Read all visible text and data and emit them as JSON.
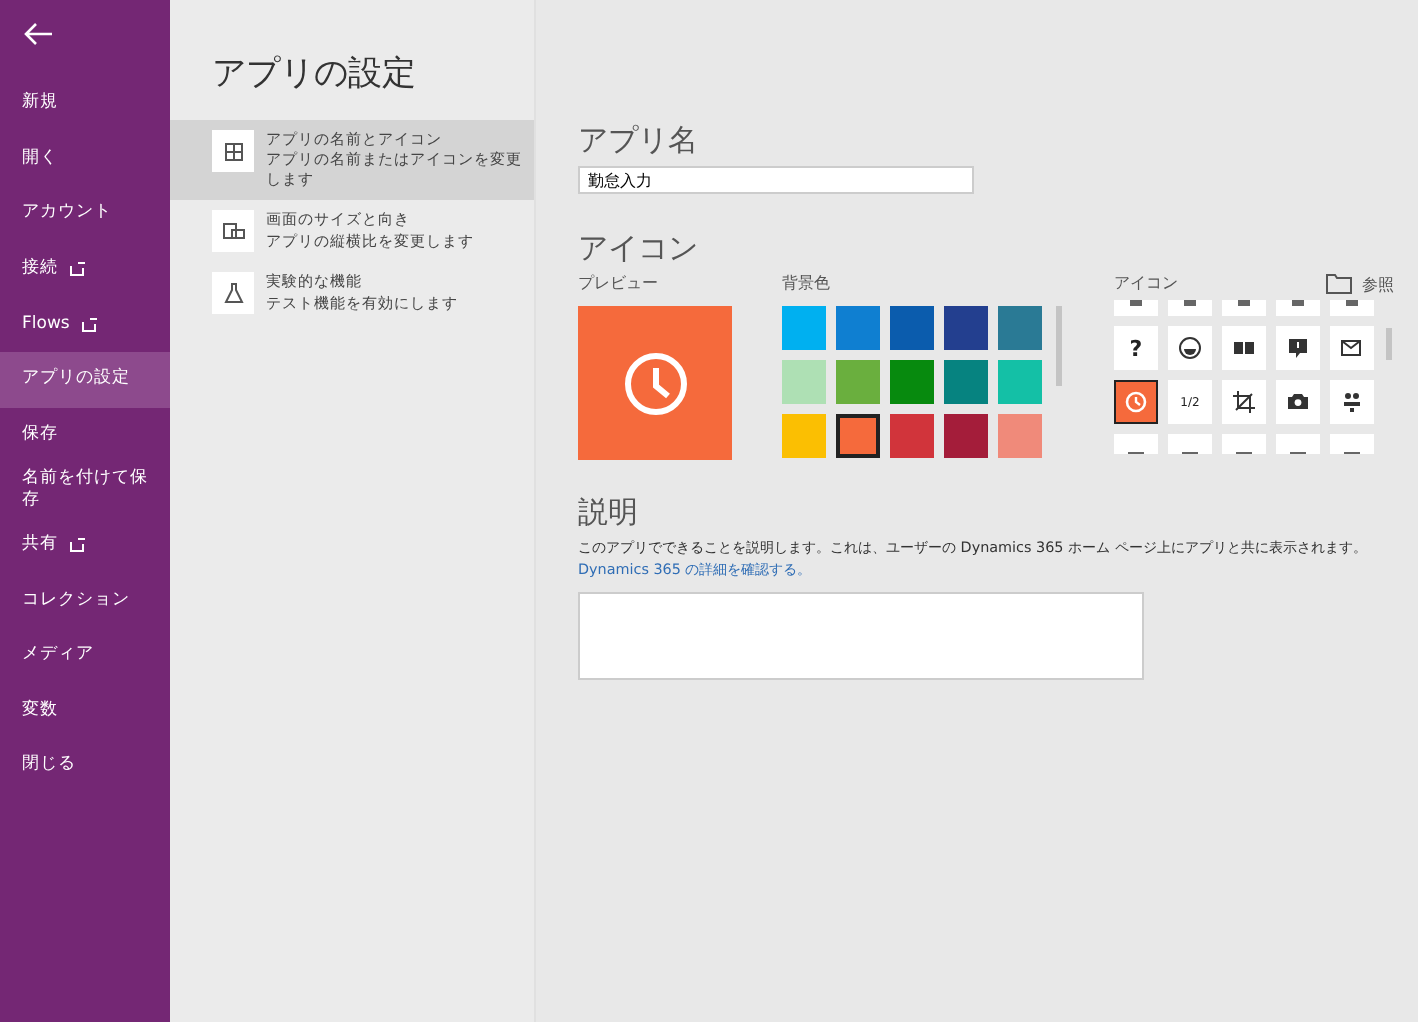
{
  "sidebar": {
    "items": [
      {
        "label": "新規",
        "external": false,
        "selected": false
      },
      {
        "label": "開く",
        "external": false,
        "selected": false
      },
      {
        "label": "アカウント",
        "external": false,
        "selected": false
      },
      {
        "label": "接続",
        "external": true,
        "selected": false
      },
      {
        "label": "Flows",
        "external": true,
        "selected": false
      },
      {
        "label": "アプリの設定",
        "external": false,
        "selected": true
      },
      {
        "label": "保存",
        "external": false,
        "selected": false
      },
      {
        "label": "名前を付けて保存",
        "external": false,
        "selected": false
      },
      {
        "label": "共有",
        "external": true,
        "selected": false
      },
      {
        "label": "コレクション",
        "external": false,
        "selected": false
      },
      {
        "label": "メディア",
        "external": false,
        "selected": false
      },
      {
        "label": "変数",
        "external": false,
        "selected": false
      },
      {
        "label": "閉じる",
        "external": false,
        "selected": false
      }
    ]
  },
  "settings": {
    "title": "アプリの設定",
    "items": [
      {
        "kind": "grid",
        "title": "アプリの名前とアイコン",
        "subtitle": "アプリの名前またはアイコンを変更します",
        "selected": true
      },
      {
        "kind": "screen",
        "title": "画面のサイズと向き",
        "subtitle": "アプリの縦横比を変更します",
        "selected": false
      },
      {
        "kind": "flask",
        "title": "実験的な機能",
        "subtitle": "テスト機能を有効にします",
        "selected": false
      }
    ]
  },
  "app_name": {
    "heading": "アプリ名",
    "value": "勤怠入力"
  },
  "icon_section": {
    "heading": "アイコン",
    "preview_label": "プレビュー",
    "background_label": "背景色",
    "icons_label": "アイコン",
    "browse": "参照",
    "colors": [
      {
        "color": "#00b0f0",
        "selected": false
      },
      {
        "color": "#0f7fd1",
        "selected": false
      },
      {
        "color": "#0b5cad",
        "selected": false
      },
      {
        "color": "#233f8f",
        "selected": false
      },
      {
        "color": "#2a7a95",
        "selected": false
      },
      {
        "color": "#aee0b4",
        "selected": false
      },
      {
        "color": "#6aaf3e",
        "selected": false
      },
      {
        "color": "#078a0e",
        "selected": false
      },
      {
        "color": "#068380",
        "selected": false
      },
      {
        "color": "#14c0a6",
        "selected": false
      },
      {
        "color": "#fbbf02",
        "selected": false
      },
      {
        "color": "#f56a3c",
        "selected": true
      },
      {
        "color": "#d1343b",
        "selected": false
      },
      {
        "color": "#a41d3a",
        "selected": false
      },
      {
        "color": "#f08a7a",
        "selected": false
      }
    ],
    "icons": [
      {
        "kind": "cut_top",
        "selected": false
      },
      {
        "kind": "cut_top",
        "selected": false
      },
      {
        "kind": "cut_top",
        "selected": false
      },
      {
        "kind": "cut_top",
        "selected": false
      },
      {
        "kind": "cut_top",
        "selected": false
      },
      {
        "kind": "glyph",
        "glyph": "?",
        "selected": false
      },
      {
        "kind": "smile",
        "selected": false
      },
      {
        "kind": "book",
        "selected": false
      },
      {
        "kind": "chat",
        "selected": false
      },
      {
        "kind": "mail",
        "selected": false
      },
      {
        "kind": "clock",
        "selected": true
      },
      {
        "kind": "glyph",
        "glyph": "1/2",
        "selected": false
      },
      {
        "kind": "crop",
        "selected": false
      },
      {
        "kind": "camera",
        "selected": false
      },
      {
        "kind": "people",
        "selected": false
      },
      {
        "kind": "generic",
        "selected": false
      },
      {
        "kind": "generic",
        "selected": false
      },
      {
        "kind": "generic",
        "selected": false
      },
      {
        "kind": "generic",
        "selected": false
      },
      {
        "kind": "generic",
        "selected": false
      }
    ]
  },
  "description": {
    "heading": "説明",
    "text": "このアプリでできることを説明します。これは、ユーザーの Dynamics 365 ホーム ページ上にアプリと共に表示されます。",
    "link": "Dynamics 365 の詳細を確認する。"
  }
}
